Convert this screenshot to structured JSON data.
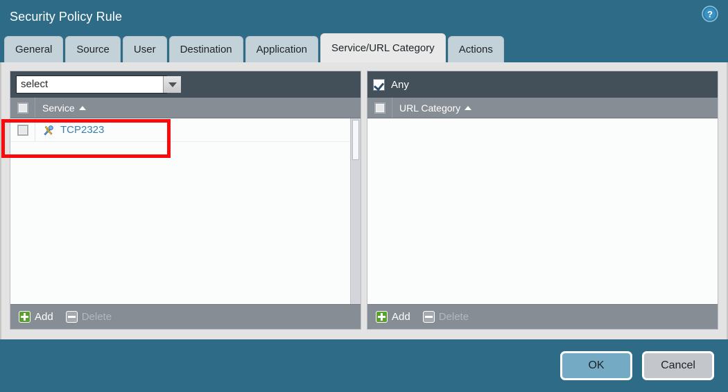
{
  "window": {
    "title": "Security Policy Rule",
    "help_icon": "help-circle-icon",
    "title_bar_color": "#2e6b87"
  },
  "tabs": [
    {
      "label": "General",
      "active": false
    },
    {
      "label": "Source",
      "active": false
    },
    {
      "label": "User",
      "active": false
    },
    {
      "label": "Destination",
      "active": false
    },
    {
      "label": "Application",
      "active": false
    },
    {
      "label": "Service/URL Category",
      "active": true
    },
    {
      "label": "Actions",
      "active": false
    }
  ],
  "service_panel": {
    "select": {
      "value": "select",
      "placeholder": "select",
      "dropdown_icon": "chevron-down-icon"
    },
    "column_header": {
      "label": "Service",
      "sort_icon": "sort-ascending-icon",
      "select_all_checkbox": false
    },
    "rows": [
      {
        "checked": false,
        "icon": "service-tools-icon",
        "label": "TCP2323",
        "highlighted": true
      }
    ],
    "footer": {
      "add_label": "Add",
      "add_icon": "plus-square-icon",
      "add_enabled": true,
      "delete_label": "Delete",
      "delete_icon": "minus-square-icon",
      "delete_enabled": false
    }
  },
  "url_panel": {
    "any": {
      "label": "Any",
      "checked": true
    },
    "column_header": {
      "label": "URL Category",
      "sort_icon": "sort-ascending-icon",
      "select_all_checkbox": false
    },
    "rows": [],
    "footer": {
      "add_label": "Add",
      "add_icon": "plus-square-icon",
      "add_enabled": true,
      "delete_label": "Delete",
      "delete_icon": "minus-square-icon",
      "delete_enabled": false
    }
  },
  "footer": {
    "ok_label": "OK",
    "cancel_label": "Cancel"
  },
  "annotation": {
    "highlight_color": "#fa0a0a",
    "target": "TCP2323 service row"
  },
  "colors": {
    "accent_blue": "#2e6b87",
    "tab_inactive": "#c3d2d8",
    "tab_active": "#e9e9e9",
    "panel_top": "#434f59",
    "col_header": "#868d95",
    "link_blue": "#3b7fa8",
    "add_green": "#5aa02c"
  }
}
